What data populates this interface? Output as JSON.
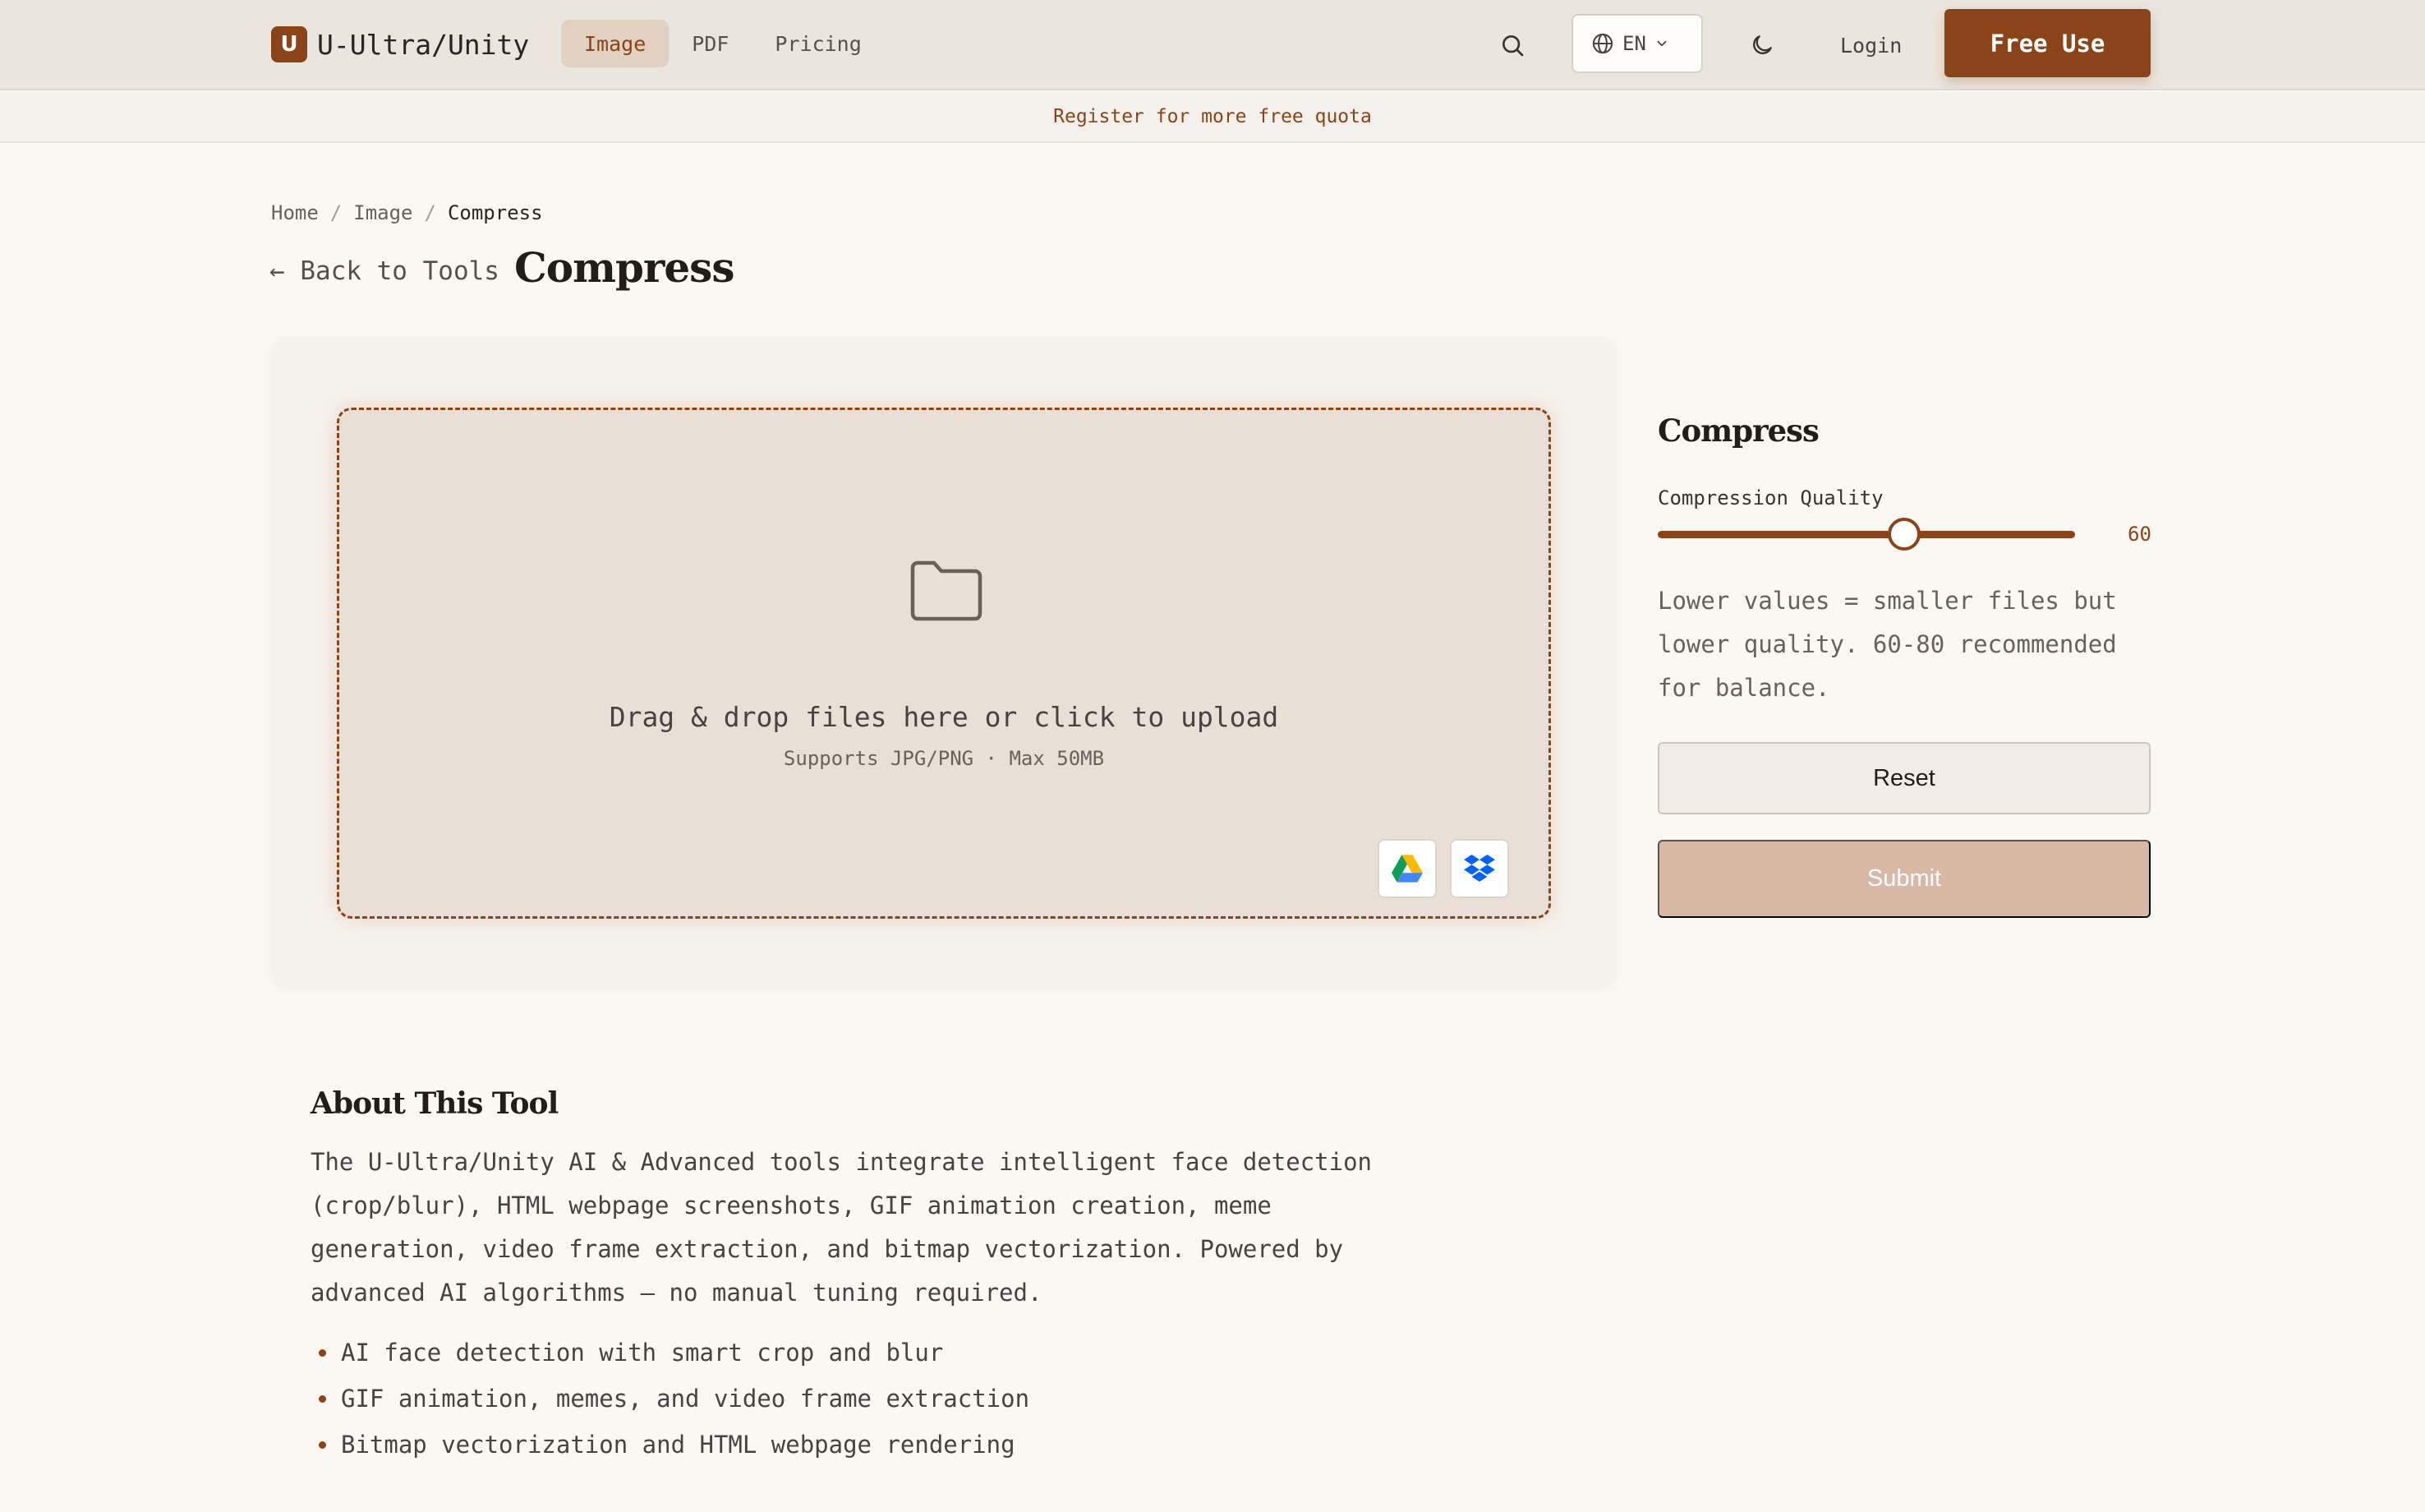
{
  "brand": {
    "logo_letter": "U",
    "name": "U-Ultra/Unity"
  },
  "nav": {
    "items": [
      {
        "label": "Image",
        "active": true
      },
      {
        "label": "PDF",
        "active": false
      },
      {
        "label": "Pricing",
        "active": false
      }
    ],
    "search_icon": "search-icon",
    "language": "EN",
    "theme_icon": "moon-icon",
    "login_label": "Login",
    "cta_label": "Free Use"
  },
  "promo_banner": "Register for more free quota",
  "breadcrumb": {
    "items": [
      "Home",
      "Image",
      "Compress"
    ],
    "separator": "/"
  },
  "back_link": "← Back to Tools",
  "page_title": "Compress",
  "upload": {
    "icon": "folder-icon",
    "title": "Drag & drop files here or click to upload",
    "subtitle": "Supports JPG/PNG · Max 50MB",
    "providers": [
      "google-drive-icon",
      "dropbox-icon"
    ]
  },
  "settings": {
    "title": "Compress",
    "quality_label": "Compression Quality",
    "quality_value": "60",
    "quality_fraction": 0.59,
    "hint": "Lower values = smaller files but lower quality. 60-80 recommended for balance.",
    "reset_label": "Reset",
    "submit_label": "Submit"
  },
  "about": {
    "title": "About This Tool",
    "description": "The U-Ultra/Unity AI & Advanced tools integrate intelligent face detection (crop/blur), HTML webpage screenshots, GIF animation creation, meme generation, video frame extraction, and bitmap vectorization. Powered by advanced AI algorithms — no manual tuning required.",
    "features": [
      "AI face detection with smart crop and blur",
      "GIF animation, memes, and video frame extraction",
      "Bitmap vectorization and HTML webpage rendering"
    ]
  },
  "colors": {
    "accent": "#8b4419",
    "background": "#fbf8f3",
    "topbar": "#ebe6dd",
    "dropzone": "#e9dfd4",
    "submit_disabled": "#d8b9a6"
  }
}
